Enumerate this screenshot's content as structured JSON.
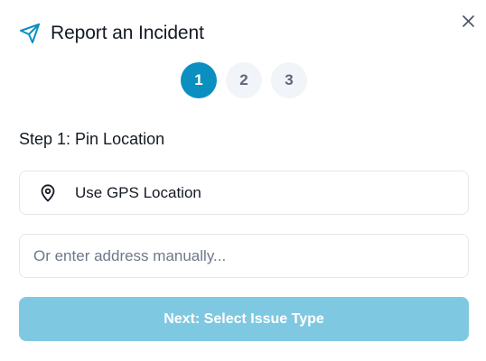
{
  "modal": {
    "title": "Report an Incident",
    "close_icon": "close-icon",
    "title_icon": "send-icon",
    "accent_color": "#0b8fc0"
  },
  "steps": [
    {
      "label": "1",
      "active": true
    },
    {
      "label": "2",
      "active": false
    },
    {
      "label": "3",
      "active": false
    }
  ],
  "location_step": {
    "heading": "Step 1: Pin Location",
    "gps_button": {
      "icon": "map-pin-icon",
      "label": "Use GPS Location"
    },
    "address_input": {
      "value": "",
      "placeholder": "Or enter address manually..."
    },
    "next_button": {
      "label": "Next: Select Issue Type",
      "disabled_color": "#7fc8e2"
    }
  }
}
